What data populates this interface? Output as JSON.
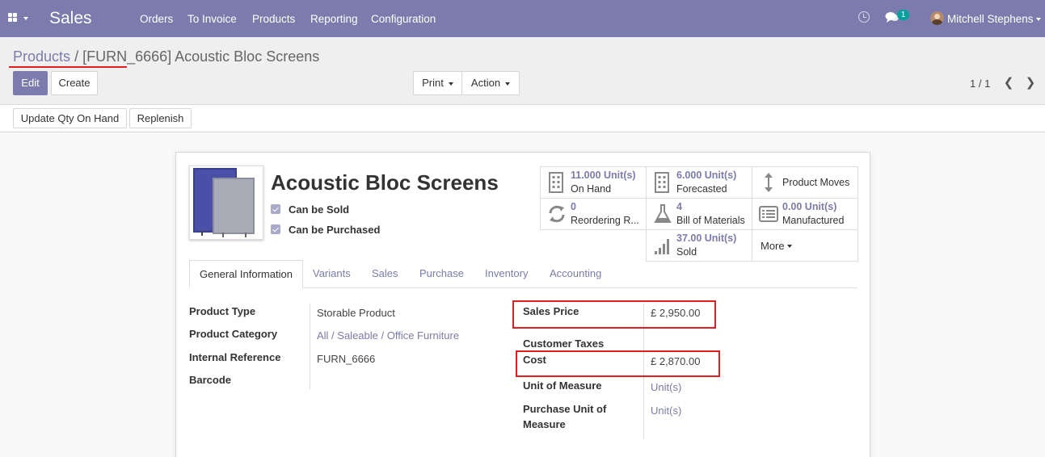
{
  "navbar": {
    "app_name": "Sales",
    "menu": [
      "Orders",
      "To Invoice",
      "Products",
      "Reporting",
      "Configuration"
    ],
    "chat_badge": "1",
    "user_name": "Mitchell Stephens"
  },
  "breadcrumb": {
    "parent": "Products",
    "separator": "/",
    "current": "[FURN_6666] Acoustic Bloc Screens"
  },
  "buttons": {
    "edit": "Edit",
    "create": "Create",
    "print": "Print",
    "action": "Action",
    "update_qty": "Update Qty On Hand",
    "replenish": "Replenish"
  },
  "pager": {
    "value": "1 / 1"
  },
  "product": {
    "name": "Acoustic Bloc Screens",
    "can_be_sold": "Can be Sold",
    "can_be_purchased": "Can be Purchased"
  },
  "smart_buttons": {
    "on_hand": {
      "value": "11.000 Unit(s)",
      "label": "On Hand"
    },
    "forecasted": {
      "value": "6.000 Unit(s)",
      "label": "Forecasted"
    },
    "product_moves": {
      "label": "Product Moves"
    },
    "reordering": {
      "value": "0",
      "label": "Reordering R..."
    },
    "bom": {
      "value": "4",
      "label": "Bill of Materials"
    },
    "manufactured": {
      "value": "0.00 Unit(s)",
      "label": "Manufactured"
    },
    "sold": {
      "value": "37.00 Unit(s)",
      "label": "Sold"
    },
    "more": "More"
  },
  "tabs": [
    "General Information",
    "Variants",
    "Sales",
    "Purchase",
    "Inventory",
    "Accounting"
  ],
  "left_fields": {
    "product_type": {
      "label": "Product Type",
      "value": "Storable Product"
    },
    "product_category": {
      "label": "Product Category",
      "value": "All / Saleable / Office Furniture"
    },
    "internal_reference": {
      "label": "Internal Reference",
      "value": "FURN_6666"
    },
    "barcode": {
      "label": "Barcode",
      "value": ""
    }
  },
  "right_fields": {
    "sales_price": {
      "label": "Sales Price",
      "value": "£ 2,950.00"
    },
    "customer_taxes": {
      "label": "Customer Taxes",
      "value": ""
    },
    "cost": {
      "label": "Cost",
      "value": "£ 2,870.00"
    },
    "uom": {
      "label": "Unit of Measure",
      "value": "Unit(s)"
    },
    "purchase_uom_line1": "Purchase Unit of",
    "purchase_uom_line2": "Measure",
    "purchase_uom_value": "Unit(s)"
  }
}
